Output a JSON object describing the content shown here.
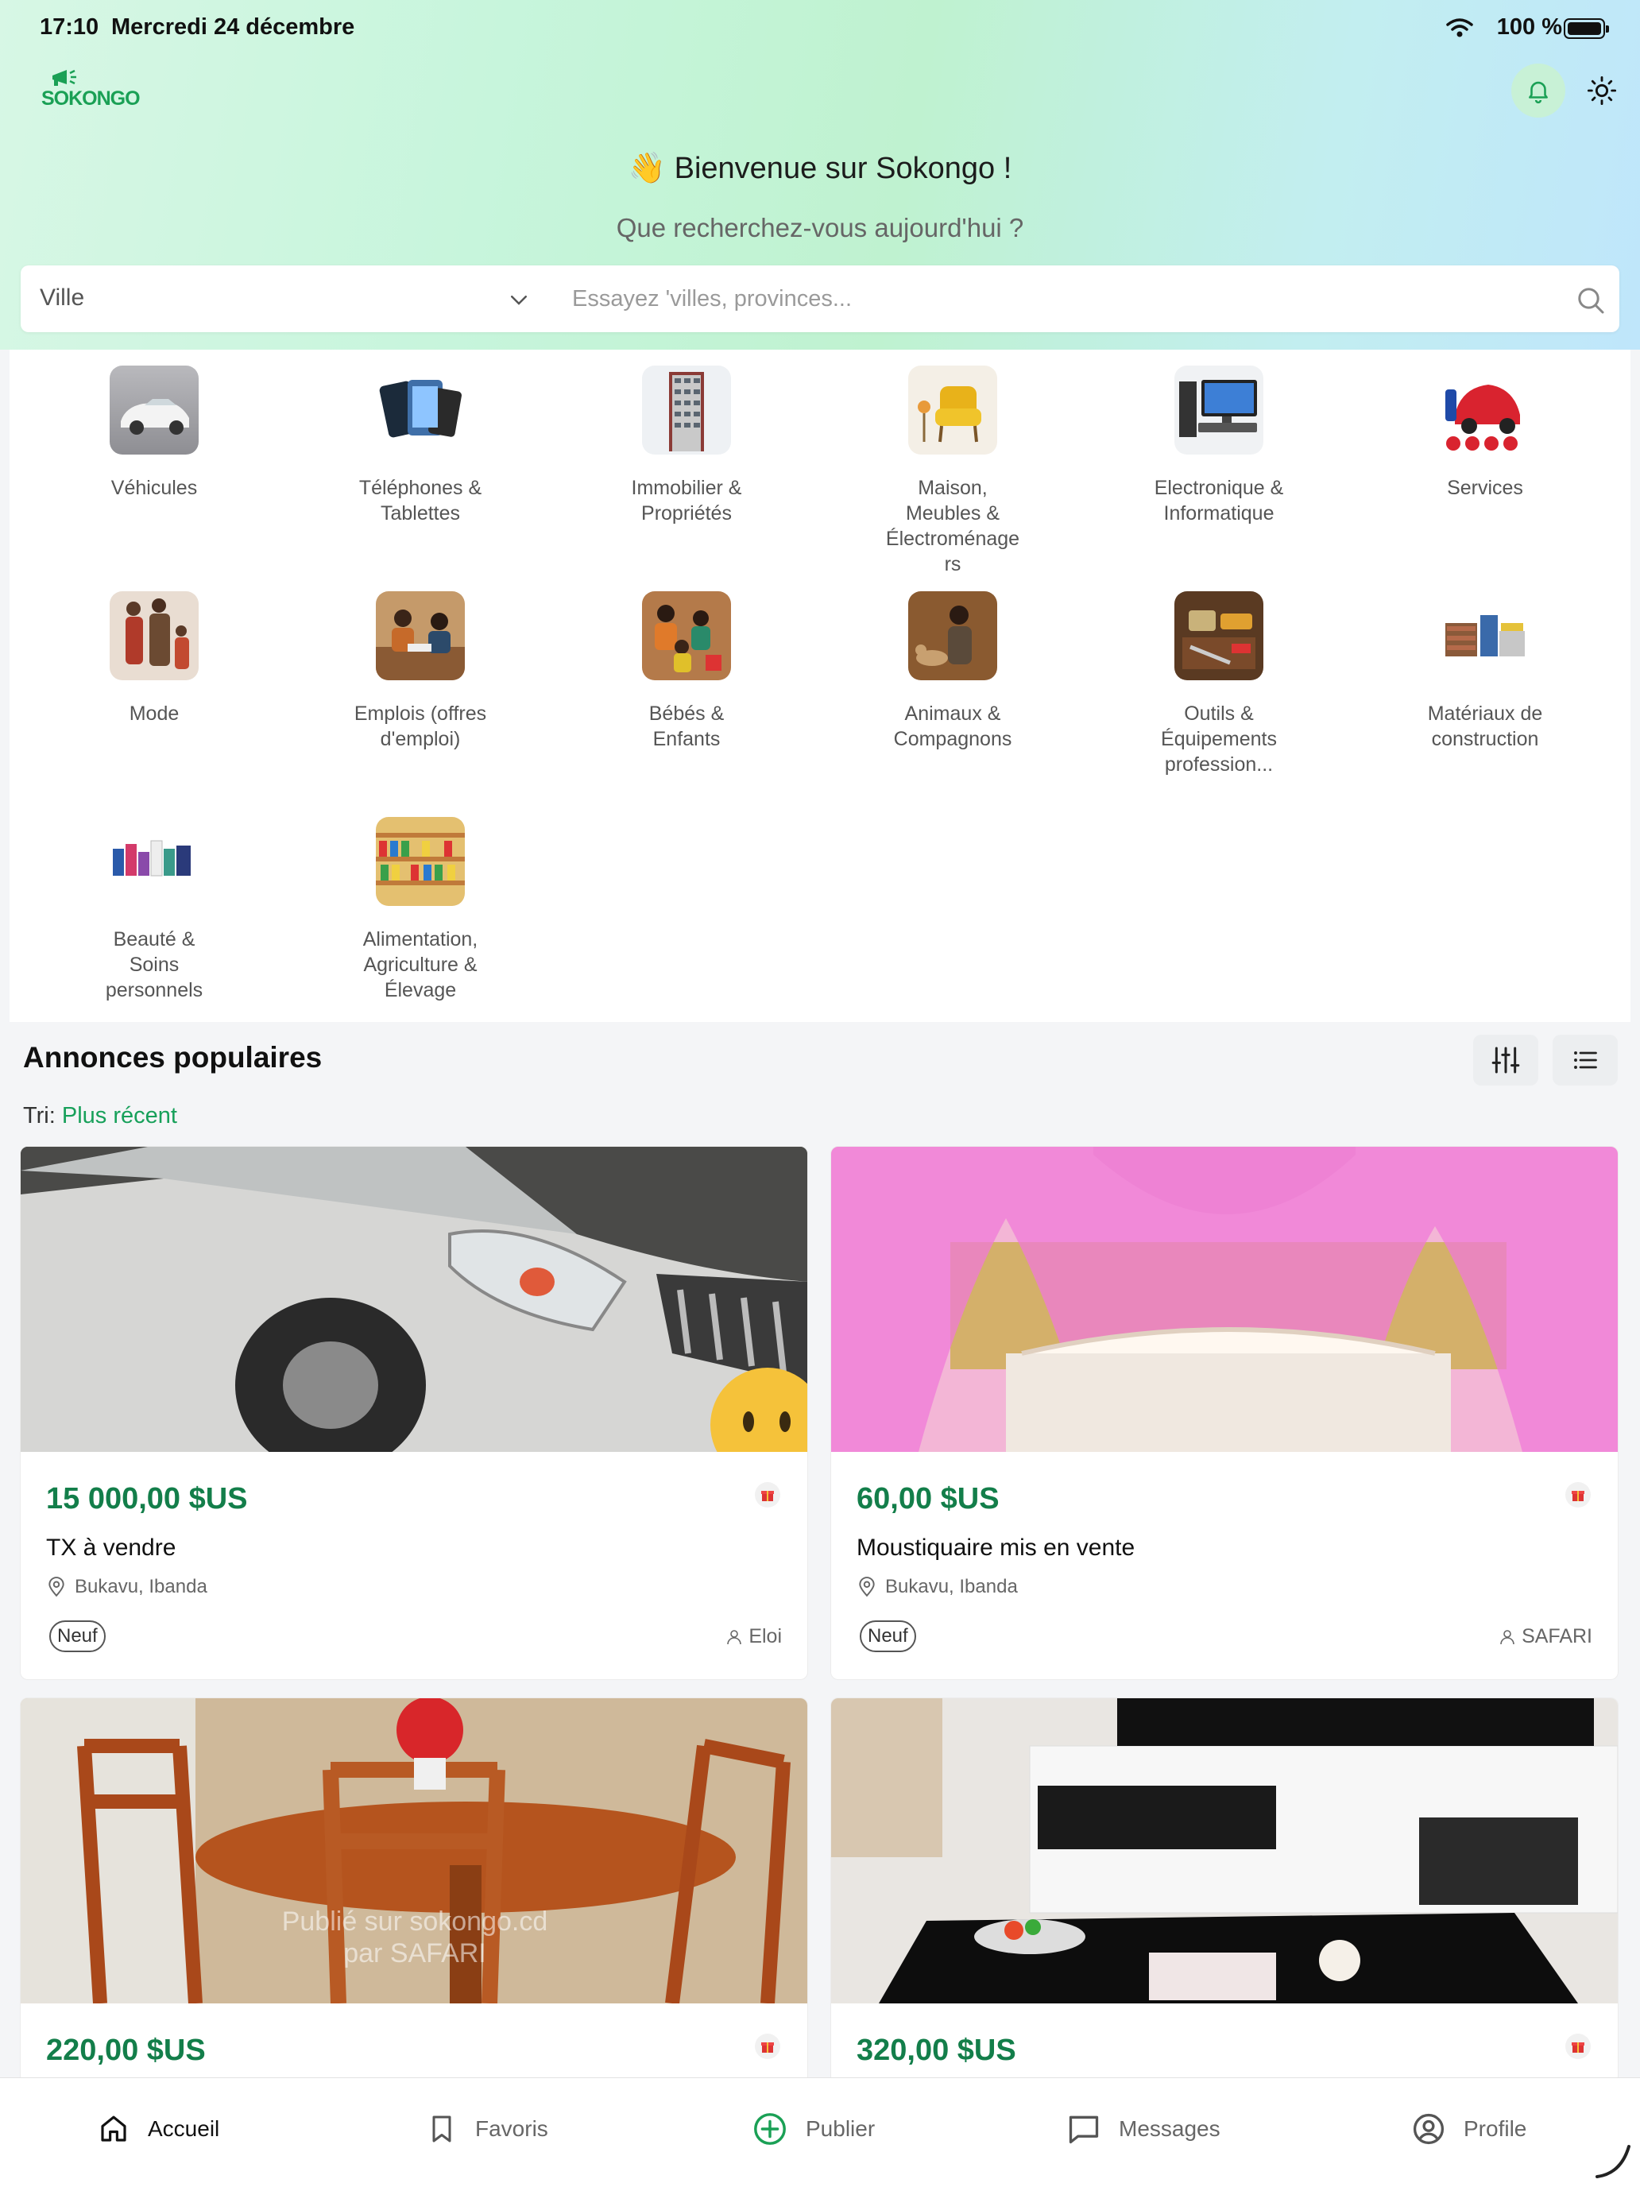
{
  "status": {
    "time": "17:10",
    "date": "Mercredi 24 décembre",
    "battery": "100 %"
  },
  "brand": {
    "name": "SOKONGO",
    "accent": "#1aa055"
  },
  "header": {
    "welcome": "👋 Bienvenue sur Sokongo !",
    "subtitle": "Que recherchez-vous aujourd'hui ?"
  },
  "search": {
    "city": "Ville",
    "placeholder": "Essayez 'villes, provinces..."
  },
  "categories": [
    {
      "label": "Véhicules",
      "icon": "car-image"
    },
    {
      "label": "Téléphones & Tablettes",
      "icon": "phones-image"
    },
    {
      "label": "Immobilier & Propriétés",
      "icon": "building-image"
    },
    {
      "label": "Maison, Meubles & Électroménagers",
      "icon": "armchair-image"
    },
    {
      "label": "Electronique & Informatique",
      "icon": "computer-image"
    },
    {
      "label": "Services",
      "icon": "services-image"
    },
    {
      "label": "Mode",
      "icon": "fashion-image"
    },
    {
      "label": "Emplois (offres d'emploi)",
      "icon": "jobs-image"
    },
    {
      "label": "Bébés & Enfants",
      "icon": "kids-image"
    },
    {
      "label": "Animaux & Compagnons",
      "icon": "animals-image"
    },
    {
      "label": "Outils & Équipements profession...",
      "icon": "tools-image"
    },
    {
      "label": "Matériaux de construction",
      "icon": "materials-image"
    },
    {
      "label": "Beauté & Soins personnels",
      "icon": "beauty-image"
    },
    {
      "label": "Alimentation, Agriculture & Élevage",
      "icon": "food-image"
    }
  ],
  "popular": {
    "title": "Annonces populaires",
    "sort_label": "Tri:",
    "sort_value": "Plus récent"
  },
  "listings": [
    {
      "price": "15 000,00 $US",
      "title": "TX à vendre",
      "location": "Bukavu, Ibanda",
      "condition": "Neuf",
      "seller": "Eloi",
      "image": "white-suv-photo"
    },
    {
      "price": "60,00 $US",
      "title": "Moustiquaire mis en vente",
      "location": "Bukavu, Ibanda",
      "condition": "Neuf",
      "seller": "SAFARI",
      "image": "pink-mosquito-net-photo"
    },
    {
      "price": "220,00 $US",
      "title": "",
      "location": "",
      "condition": "",
      "seller": "",
      "image": "wooden-table-chairs-photo",
      "watermark": "Publié sur sokongo.cd\npar SAFARI"
    },
    {
      "price": "320,00 $US",
      "title": "",
      "location": "",
      "condition": "",
      "seller": "",
      "image": "tv-stand-coffee-table-photo"
    }
  ],
  "tabs": [
    {
      "label": "Accueil",
      "icon": "home-icon"
    },
    {
      "label": "Favoris",
      "icon": "bookmark-icon"
    },
    {
      "label": "Publier",
      "icon": "plus-circle-icon"
    },
    {
      "label": "Messages",
      "icon": "message-icon"
    },
    {
      "label": "Profile",
      "icon": "user-circle-icon"
    }
  ]
}
